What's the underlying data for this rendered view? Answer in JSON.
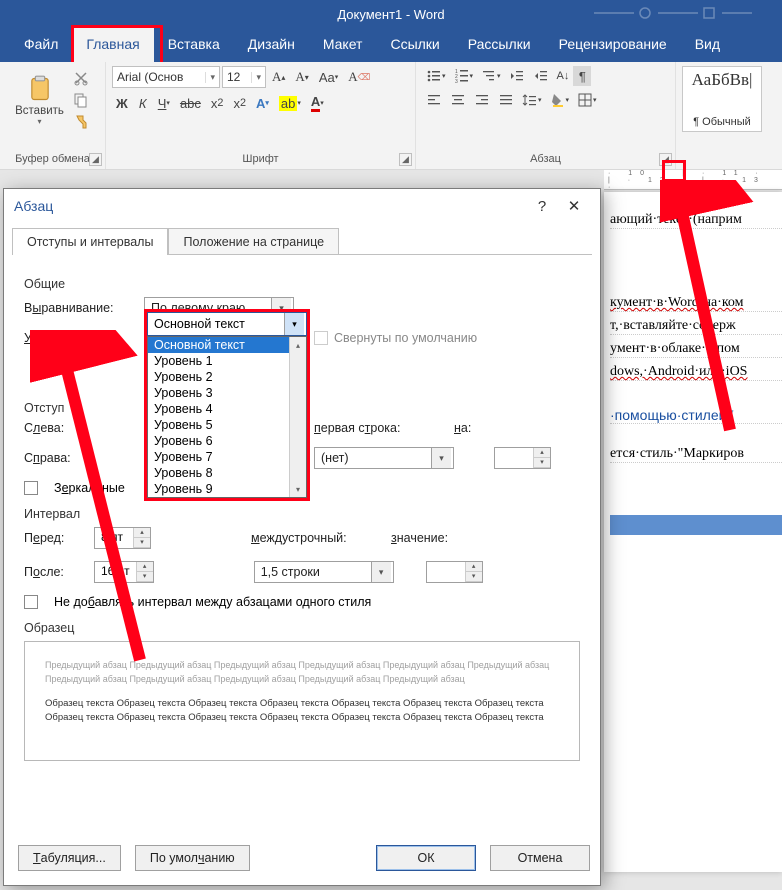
{
  "titlebar": {
    "title": "Документ1 - Word"
  },
  "tabs": {
    "items": [
      "Файл",
      "Главная",
      "Вставка",
      "Дизайн",
      "Макет",
      "Ссылки",
      "Рассылки",
      "Рецензирование",
      "Вид"
    ],
    "active_index": 1
  },
  "ribbon": {
    "clipboard": {
      "paste": "Вставить",
      "group": "Буфер обмена"
    },
    "font": {
      "name": "Arial (Основ",
      "size": "12",
      "group": "Шрифт"
    },
    "paragraph": {
      "group": "Абзац"
    },
    "styles": {
      "sample": "АаБбВв|",
      "name": "¶ Обычный"
    }
  },
  "dialog": {
    "title": "Абзац",
    "tab_indents": "Отступы и интервалы",
    "tab_position": "Положение на странице",
    "section_general": "Общие",
    "align_label_pre": "В",
    "align_label_hot": "ы",
    "align_label_post": "равнивание:",
    "align_value": "По левому краю",
    "level_label_pre": "",
    "level_label_hot": "У",
    "level_label_post": "ровень:",
    "level_value": "Основной текст",
    "level_options": [
      "Основной текст",
      "Уровень 1",
      "Уровень 2",
      "Уровень 3",
      "Уровень 4",
      "Уровень 5",
      "Уровень 6",
      "Уровень 7",
      "Уровень 8",
      "Уровень 9"
    ],
    "collapsed_cb": "Свернуты по умолчанию",
    "section_indent": "Отступ",
    "left_lbl_pre": "С",
    "left_lbl_hot": "л",
    "left_lbl_post": "ева:",
    "right_lbl_pre": "С",
    "right_lbl_hot": "п",
    "right_lbl_post": "рава:",
    "firstline_lbl": "первая строка:",
    "firstline_val": "(нет)",
    "by_lbl_pre": "н",
    "by_lbl_post": "а:",
    "mirror_cb_pre": "З",
    "mirror_cb_hot": "е",
    "mirror_cb_post": "ркальные ",
    "section_spacing": "Интервал",
    "before_lbl_pre": "П",
    "before_lbl_hot": "е",
    "before_lbl_post": "ред:",
    "before_val": "8 пт",
    "after_lbl_pre": "П",
    "after_lbl_hot": "о",
    "after_lbl_post": "сле:",
    "after_val": "16 пт",
    "linesp_lbl": "междустрочный:",
    "linesp_val": "1,5 строки",
    "value_lbl": "значение:",
    "nospace_cb": "Не добавлять интервал между абзацами одного стиля",
    "section_preview": "Образец",
    "preview_prev": "Предыдущий абзац Предыдущий абзац Предыдущий абзац Предыдущий абзац Предыдущий абзац Предыдущий абзац Предыдущий абзац Предыдущий абзац Предыдущий абзац Предыдущий абзац Предыдущий абзац",
    "preview_sample": "Образец текста Образец текста Образец текста Образец текста Образец текста Образец текста Образец текста Образец текста Образец текста Образец текста Образец текста Образец текста Образец текста Образец текста",
    "btn_tabs": "Табуляция...",
    "btn_default": "По умолчанию",
    "btn_ok": "ОК",
    "btn_cancel": "Отмена"
  },
  "document": {
    "ruler": "· 10 · | · 11 · | · 12 · | · 13 ·",
    "lines": [
      {
        "t": "ающий·текст·(наприм",
        "cls": ""
      },
      {
        "t": "",
        "cls": ""
      },
      {
        "t": "кумент·в·Word·на·ком",
        "cls": "sq"
      },
      {
        "t": "т,·вставляйте·содерж",
        "cls": ""
      },
      {
        "t": "умент·в·облаке·с·пом",
        "cls": ""
      },
      {
        "t": "dows,·Android·или·iOS",
        "cls": "sq"
      },
      {
        "t": "·помощью·стилей¶",
        "cls": "blue"
      },
      {
        "t": "ется·стиль·\"Маркиров",
        "cls": ""
      }
    ]
  }
}
